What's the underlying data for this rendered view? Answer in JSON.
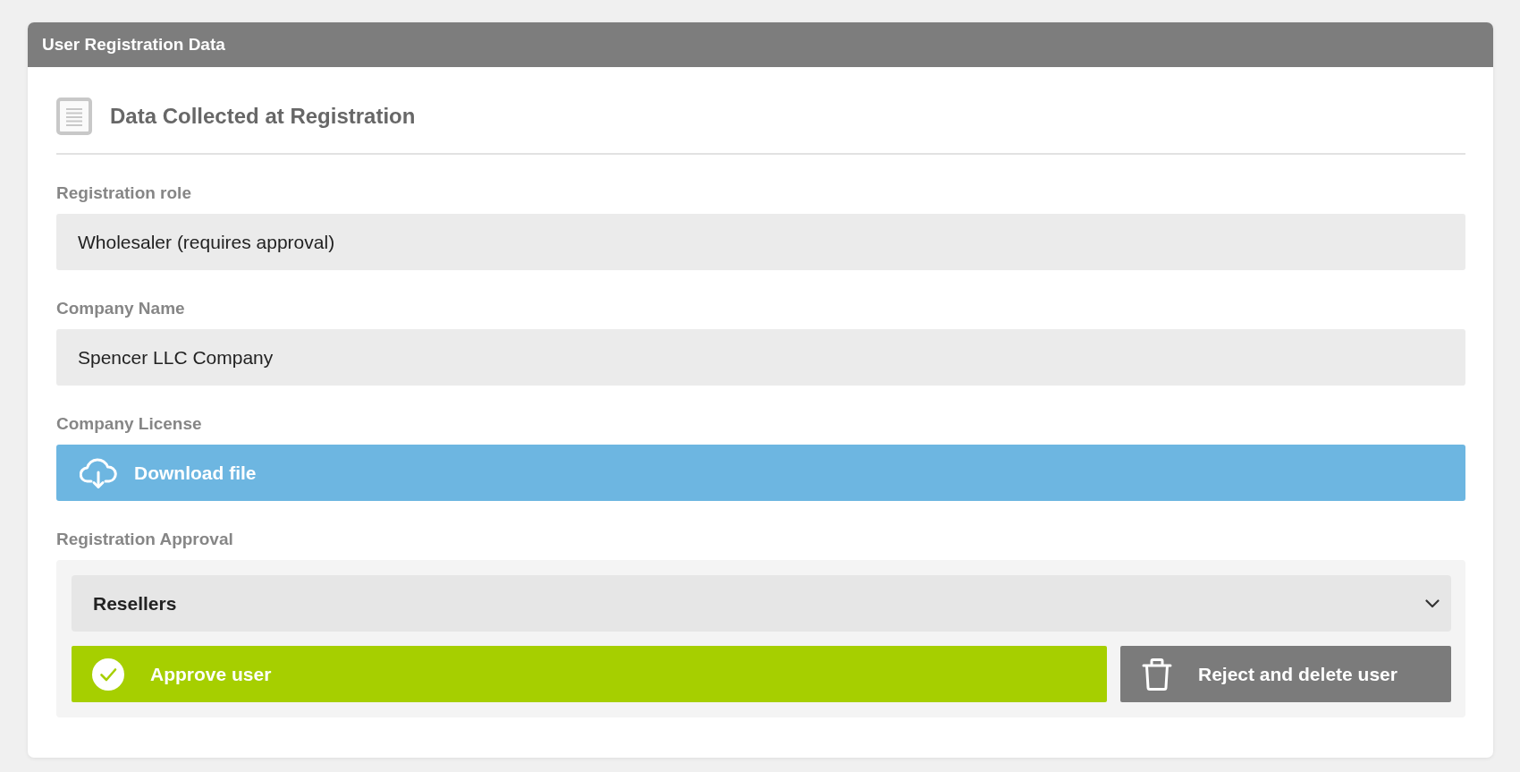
{
  "panel": {
    "title": "User Registration Data"
  },
  "section": {
    "heading": "Data Collected at Registration"
  },
  "fields": [
    {
      "kind": "text",
      "label": "Registration role",
      "value": "Wholesaler (requires approval)"
    },
    {
      "kind": "text",
      "label": "Company Name",
      "value": "Spencer LLC Company"
    },
    {
      "kind": "file",
      "label": "Company License",
      "button": "Download file"
    }
  ],
  "approval": {
    "label": "Registration Approval",
    "select": {
      "value": "Resellers"
    },
    "buttons": [
      {
        "kind": "approve",
        "label": "Approve user"
      },
      {
        "kind": "reject",
        "label": "Reject and delete user"
      }
    ]
  }
}
